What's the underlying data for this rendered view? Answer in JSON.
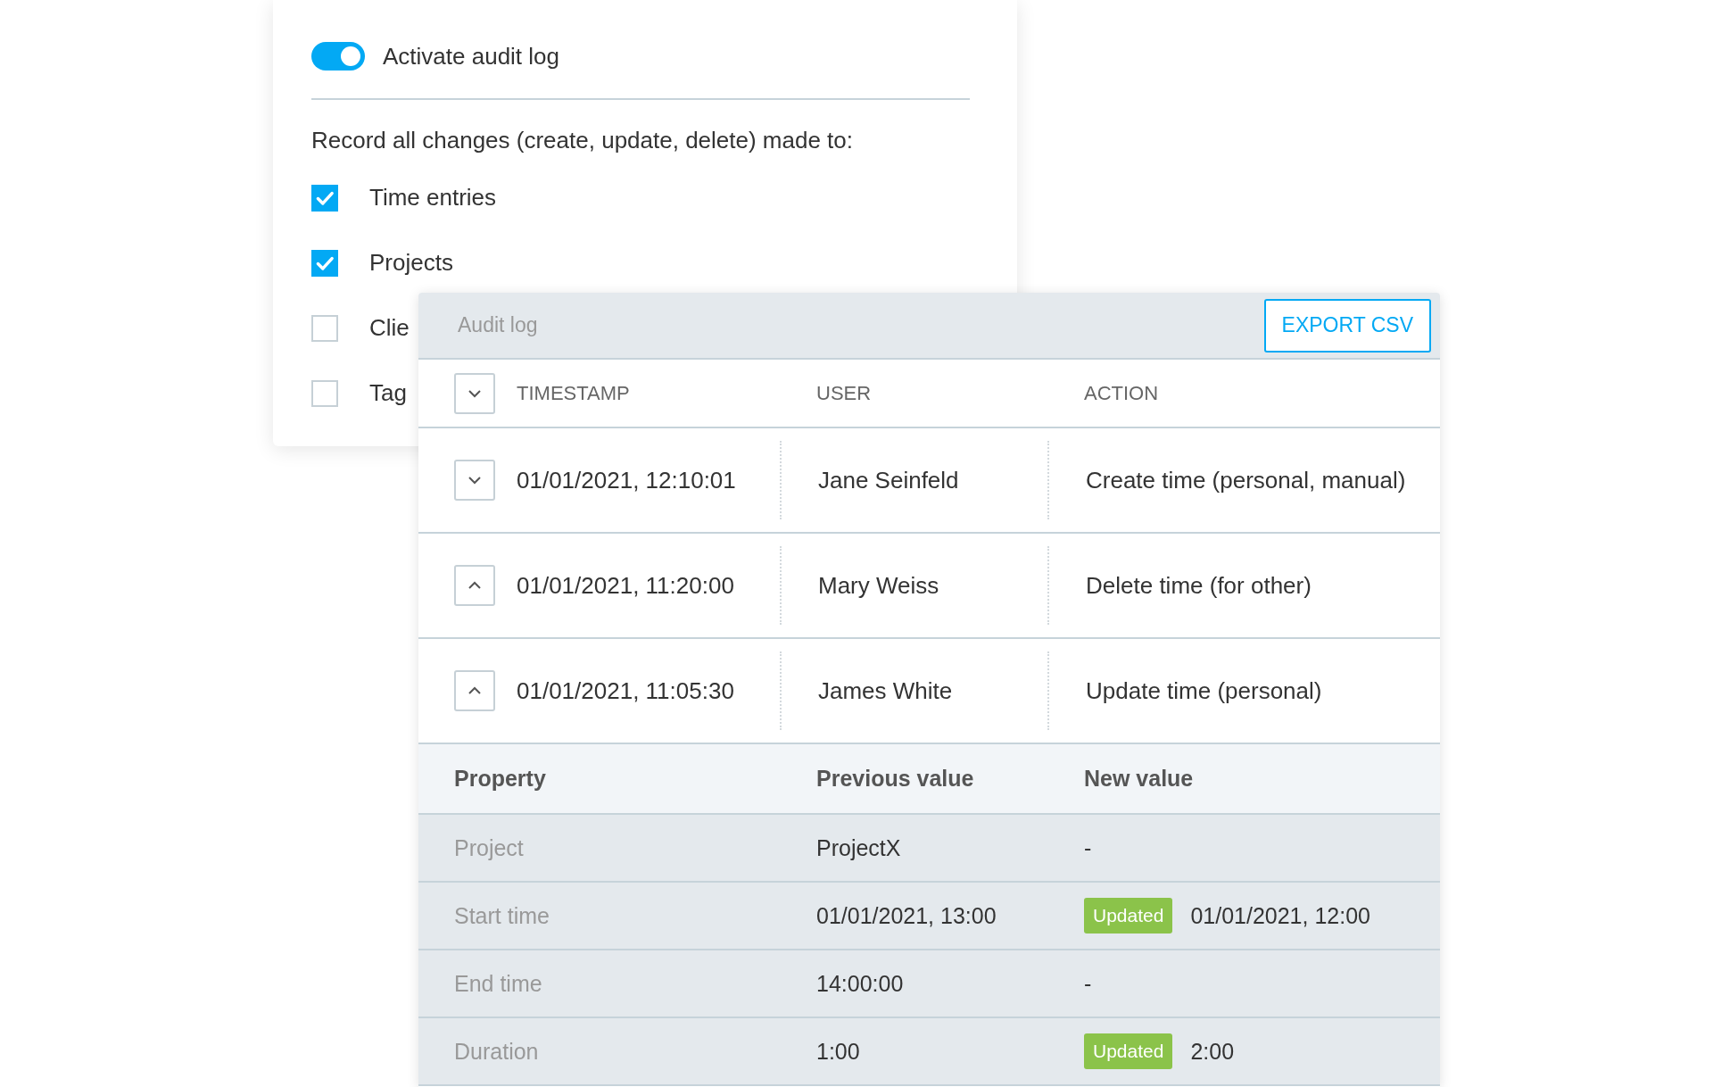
{
  "settings": {
    "toggle": {
      "label": "Activate audit log",
      "on": true
    },
    "intro": "Record all changes (create, update, delete) made to:",
    "options": [
      {
        "label": "Time entries",
        "checked": true
      },
      {
        "label": "Projects",
        "checked": true
      },
      {
        "label": "Clie",
        "checked": false
      },
      {
        "label": "Tag",
        "checked": false
      }
    ]
  },
  "audit_log": {
    "title": "Audit log",
    "export_button": "EXPORT CSV",
    "header_expanded": false,
    "columns": [
      "TIMESTAMP",
      "USER",
      "ACTION"
    ],
    "rows": [
      {
        "timestamp": "01/01/2021, 12:10:01",
        "user": "Jane Seinfeld",
        "action": "Create time (personal, manual)",
        "expanded": false
      },
      {
        "timestamp": "01/01/2021, 11:20:00",
        "user": "Mary Weiss",
        "action": "Delete time (for other)",
        "expanded": true
      },
      {
        "timestamp": "01/01/2021, 11:05:30",
        "user": "James White",
        "action": "Update time (personal)",
        "expanded": true,
        "detail_columns": [
          "Property",
          "Previous value",
          "New value"
        ],
        "details": [
          {
            "property": "Project",
            "previous": "ProjectX",
            "new": "-",
            "updated": false
          },
          {
            "property": "Start time",
            "previous": "01/01/2021, 13:00",
            "new": "01/01/2021, 12:00",
            "updated": true,
            "badge": "Updated"
          },
          {
            "property": "End time",
            "previous": "14:00:00",
            "new": "-",
            "updated": false
          },
          {
            "property": "Duration",
            "previous": "1:00",
            "new": "2:00",
            "updated": true,
            "badge": "Updated"
          }
        ]
      }
    ]
  }
}
